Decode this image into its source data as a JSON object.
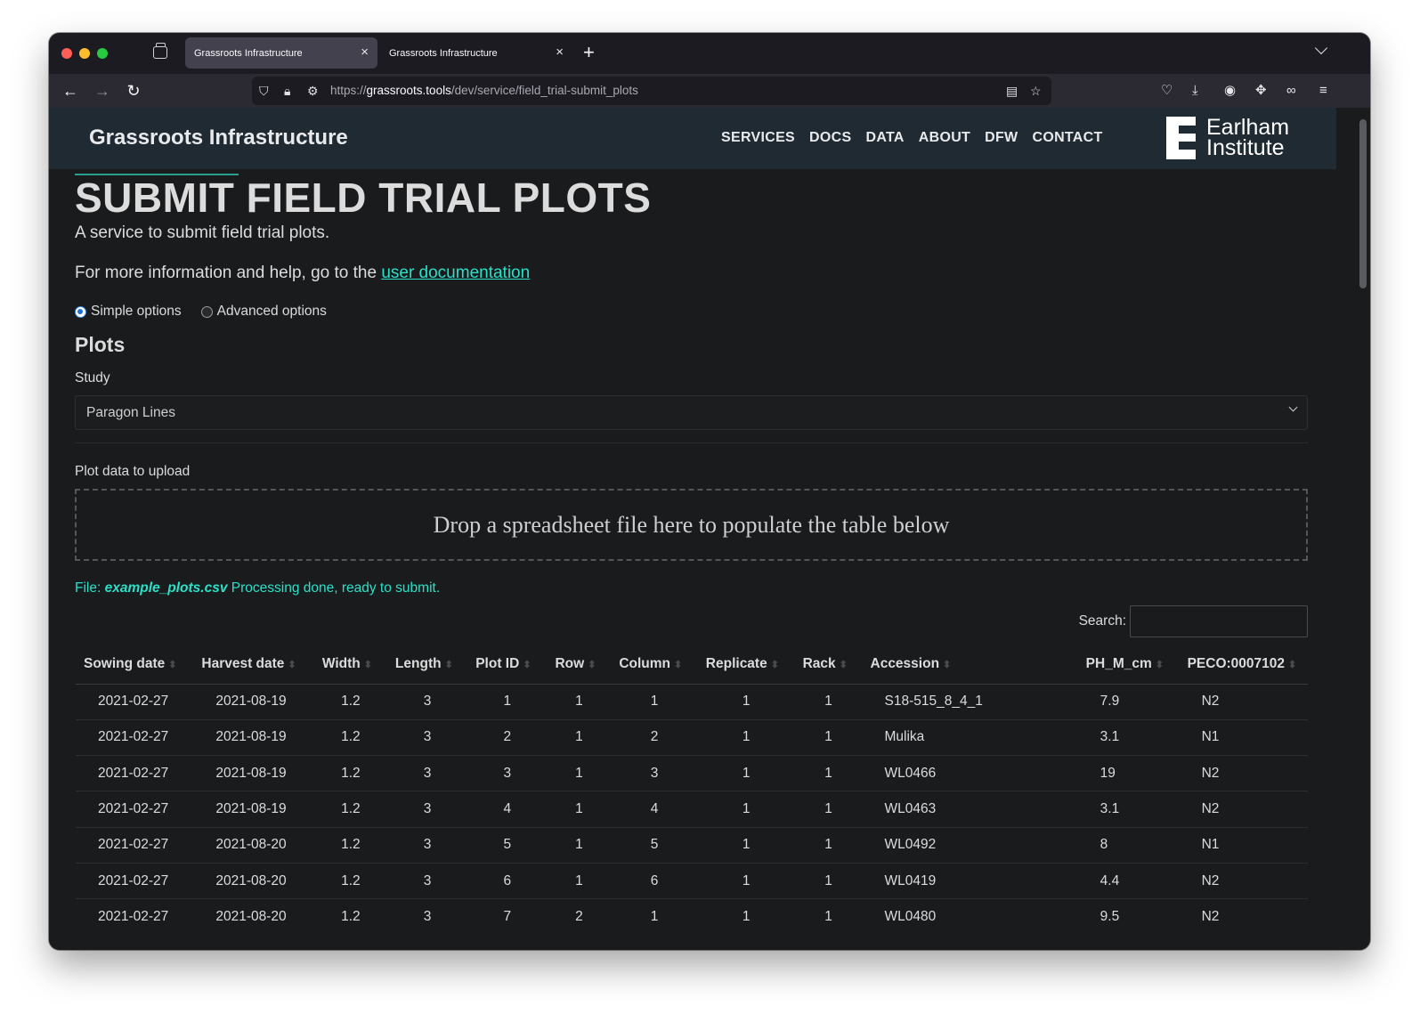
{
  "browser": {
    "tabs": [
      {
        "title": "Grassroots Infrastructure",
        "active": true
      },
      {
        "title": "Grassroots Infrastructure",
        "active": false
      }
    ],
    "url_prefix": "https://",
    "url_host": "grassroots.tools",
    "url_path": "/dev/service/field_trial-submit_plots"
  },
  "header": {
    "site_title": "Grassroots Infrastructure",
    "nav": [
      "SERVICES",
      "DOCS",
      "DATA",
      "ABOUT",
      "DFW",
      "CONTACT"
    ],
    "logo_line1": "Earlham",
    "logo_line2": "Institute"
  },
  "main": {
    "title": "SUBMIT FIELD TRIAL PLOTS",
    "subtitle": "A service to submit field trial plots.",
    "help_prefix": "For more information and help, go to the",
    "help_link": "user documentation",
    "radio_simple": "Simple options",
    "radio_advanced": "Advanced options",
    "section": "Plots",
    "study_label": "Study",
    "study_value": "Paragon Lines",
    "upload_label": "Plot data to upload",
    "dropzone_text": "Drop a spreadsheet file here to populate the table below",
    "file_prefix": "File:",
    "file_name": "example_plots.csv",
    "file_status": "Processing done, ready to submit.",
    "search_label": "Search:"
  },
  "table": {
    "columns": [
      "Sowing date",
      "Harvest date",
      "Width",
      "Length",
      "Plot ID",
      "Row",
      "Column",
      "Replicate",
      "Rack",
      "Accession",
      "PH_M_cm",
      "PECO:0007102"
    ],
    "rows": [
      [
        "2021-02-27",
        "2021-08-19",
        "1.2",
        "3",
        "1",
        "1",
        "1",
        "1",
        "1",
        "S18-515_8_4_1",
        "7.9",
        "N2"
      ],
      [
        "2021-02-27",
        "2021-08-19",
        "1.2",
        "3",
        "2",
        "1",
        "2",
        "1",
        "1",
        "Mulika",
        "3.1",
        "N1"
      ],
      [
        "2021-02-27",
        "2021-08-19",
        "1.2",
        "3",
        "3",
        "1",
        "3",
        "1",
        "1",
        "WL0466",
        "19",
        "N2"
      ],
      [
        "2021-02-27",
        "2021-08-19",
        "1.2",
        "3",
        "4",
        "1",
        "4",
        "1",
        "1",
        "WL0463",
        "3.1",
        "N2"
      ],
      [
        "2021-02-27",
        "2021-08-20",
        "1.2",
        "3",
        "5",
        "1",
        "5",
        "1",
        "1",
        "WL0492",
        "8",
        "N1"
      ],
      [
        "2021-02-27",
        "2021-08-20",
        "1.2",
        "3",
        "6",
        "1",
        "6",
        "1",
        "1",
        "WL0419",
        "4.4",
        "N2"
      ],
      [
        "2021-02-27",
        "2021-08-20",
        "1.2",
        "3",
        "7",
        "2",
        "1",
        "1",
        "1",
        "WL0480",
        "9.5",
        "N2"
      ]
    ]
  }
}
